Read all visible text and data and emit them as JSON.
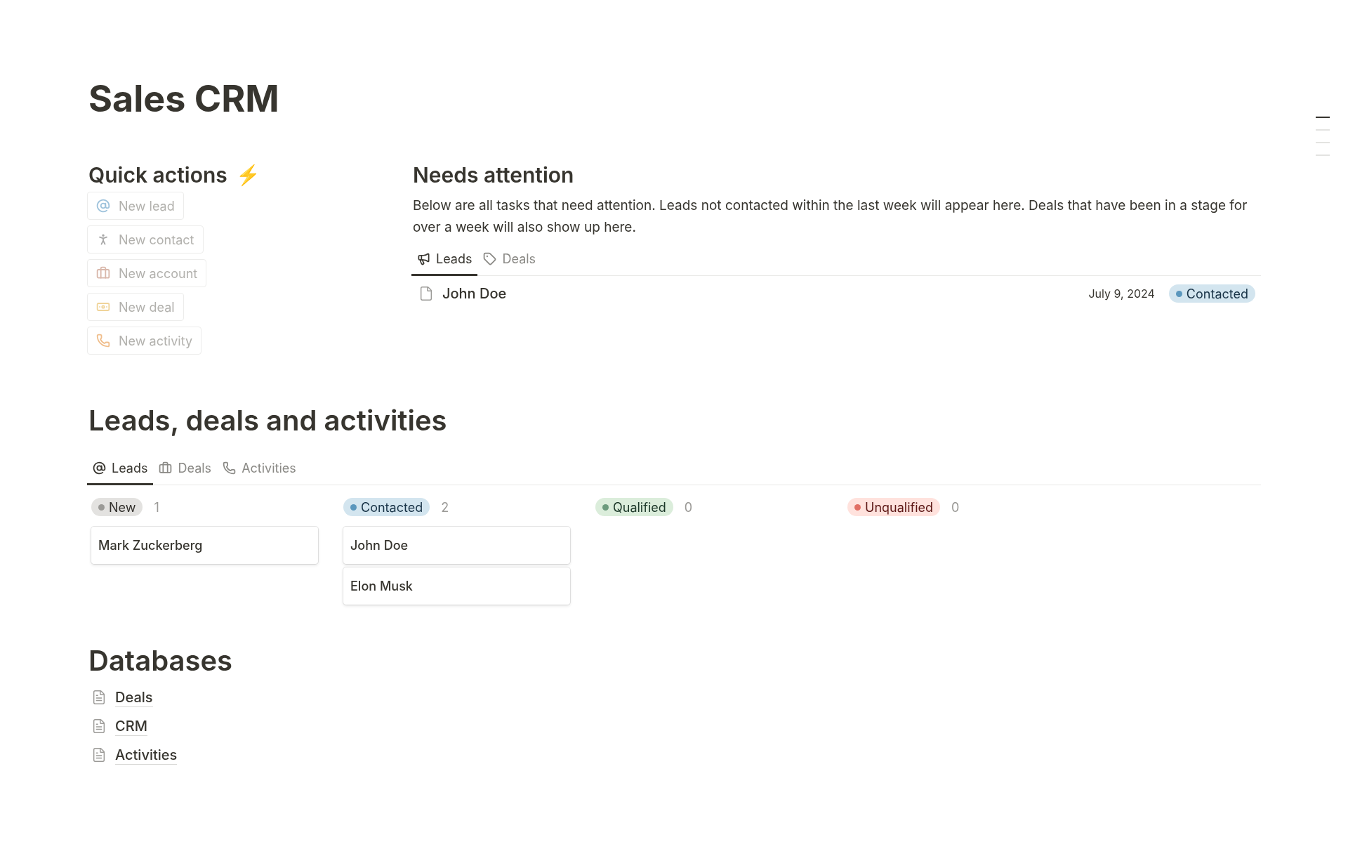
{
  "page_title": "Sales CRM",
  "quick_actions": {
    "title": "Quick actions",
    "title_emoji": "⚡",
    "buttons": [
      {
        "label": "New lead",
        "kind": "at"
      },
      {
        "label": "New contact",
        "kind": "person"
      },
      {
        "label": "New account",
        "kind": "briefcase"
      },
      {
        "label": "New deal",
        "kind": "money"
      },
      {
        "label": "New activity",
        "kind": "phone"
      }
    ]
  },
  "needs_attention": {
    "title": "Needs attention",
    "description": "Below are all tasks that need attention. Leads not contacted within the last week will appear here. Deals that have been in a stage for over a week will also show up here.",
    "tabs": [
      {
        "label": "Leads",
        "kind": "megaphone",
        "selected": true
      },
      {
        "label": "Deals",
        "kind": "tag",
        "selected": false
      }
    ],
    "rows": [
      {
        "name": "John Doe",
        "date": "July 9, 2024",
        "status": "Contacted",
        "color": "#5b97bd"
      }
    ]
  },
  "board": {
    "title": "Leads, deals and activities",
    "tabs": [
      {
        "label": "Leads",
        "kind": "at",
        "selected": true
      },
      {
        "label": "Deals",
        "kind": "briefcase",
        "selected": false
      },
      {
        "label": "Activities",
        "kind": "phone",
        "selected": false
      }
    ],
    "columns": [
      {
        "status": "New",
        "count": "1",
        "color": "#9b9a97",
        "cards": [
          "Mark Zuckerberg"
        ]
      },
      {
        "status": "Contacted",
        "count": "2",
        "color": "#5b97bd",
        "cards": [
          "John Doe",
          "Elon Musk"
        ]
      },
      {
        "status": "Qualified",
        "count": "0",
        "color": "#6c9b7d"
      },
      {
        "status": "Unqualified",
        "count": "0",
        "color": "#e16f64"
      }
    ]
  },
  "databases": {
    "title": "Databases",
    "items": [
      "Deals",
      "CRM",
      "Activities"
    ]
  },
  "outline": [
    {
      "selected": true
    },
    {
      "selected": false
    },
    {
      "selected": false
    },
    {
      "selected": false
    }
  ]
}
